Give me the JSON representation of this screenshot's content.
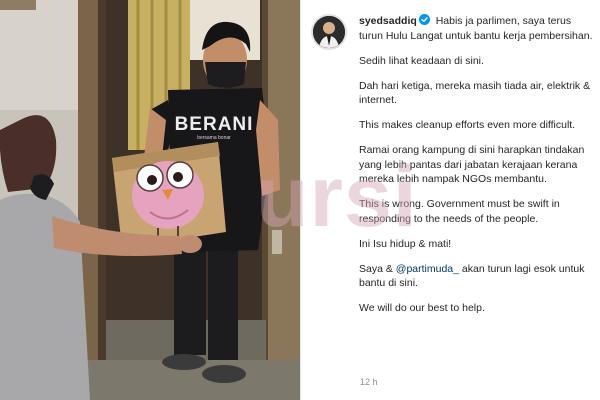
{
  "post": {
    "username": "syedsaddiq",
    "caption_first_line": "Habis ja parlimen, saya terus turun Hulu Langat untuk bantu kerja pembersihan.",
    "paragraphs": [
      "Sedih lihat keadaan di sini.",
      "Dah hari ketiga, mereka masih tiada air, elektrik & internet.",
      "This makes cleanup efforts even more difficult.",
      "Ramai orang kampung di sini harapkan tindakan yang lebih pantas dari jabatan kerajaan kerana mereka lebih nampak NGOs membantu.",
      "This is wrong. Government must be swift in responding to the needs of the people.",
      "Ini Isu hidup & mati!"
    ],
    "mention_para": {
      "before": "Saya & ",
      "mention": "@partimuda_",
      "after": " akan turun lagi esok untuk bantu di sini."
    },
    "closing": "We will do our best to help.",
    "timestamp": "12 h"
  },
  "photo": {
    "shirt_text": "BERANI",
    "shirt_subtext": "bersama bonar"
  },
  "watermark": "ursi",
  "colors": {
    "verified": "#0095f6",
    "mention": "#00376b",
    "text": "#262626",
    "muted": "#8e8e8e",
    "watermark": "#d4a6b4"
  },
  "icons": {
    "verified": "verified-badge-icon"
  }
}
